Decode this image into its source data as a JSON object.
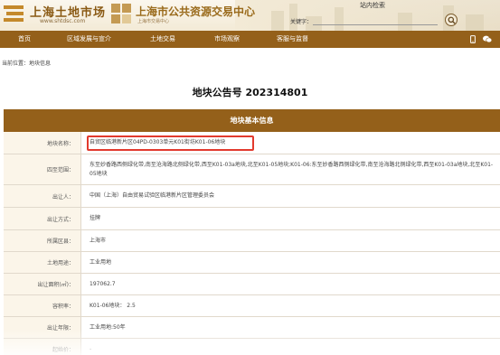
{
  "header": {
    "brand1_title": "上海土地市场",
    "brand1_url": "www.shtdsc.com",
    "brand2_title": "上海市公共资源交易中心",
    "brand2_sub": "上海市交易中心",
    "search_title": "站内检索",
    "search_label": "关键字：",
    "search_value": ""
  },
  "nav": {
    "items": [
      "首页",
      "区域发展与宣介",
      "土地交易",
      "市场观察",
      "客服与监督"
    ]
  },
  "breadcrumb": {
    "prefix": "当前位置：",
    "current": "地块信息"
  },
  "page_title": "地块公告号 202314801",
  "table": {
    "heading": "地块基本信息",
    "rows": [
      {
        "label": "地块名称：",
        "value": "自贸区临港新片区04PD-0303单元K01街坊K01-06地块"
      },
      {
        "label": "四至范围：",
        "value": "东至妙香路西侧绿化带,南至沧海路北侧绿化带,西至K01-03a地块,北至K01-05地块;K01-06:东至妙香路西侧绿化带,南至沧海路北侧绿化带,西至K01-03a地块,北至K01-05地块"
      },
      {
        "label": "出让人：",
        "value": "中国（上海）自由贸易试验区临港新片区管理委员会"
      },
      {
        "label": "出让方式：",
        "value": "挂牌"
      },
      {
        "label": "所属区县：",
        "value": "上海市"
      },
      {
        "label": "土地用途：",
        "value": "工业用地"
      },
      {
        "label": "出让面积(㎡)：",
        "value": "197062.7"
      },
      {
        "label": "容积率：",
        "value": "K01-06地块： 2.5"
      },
      {
        "label": "出让年限：",
        "value": "工业用地:50年"
      },
      {
        "label": "起始价：",
        "value": "-"
      }
    ]
  }
}
